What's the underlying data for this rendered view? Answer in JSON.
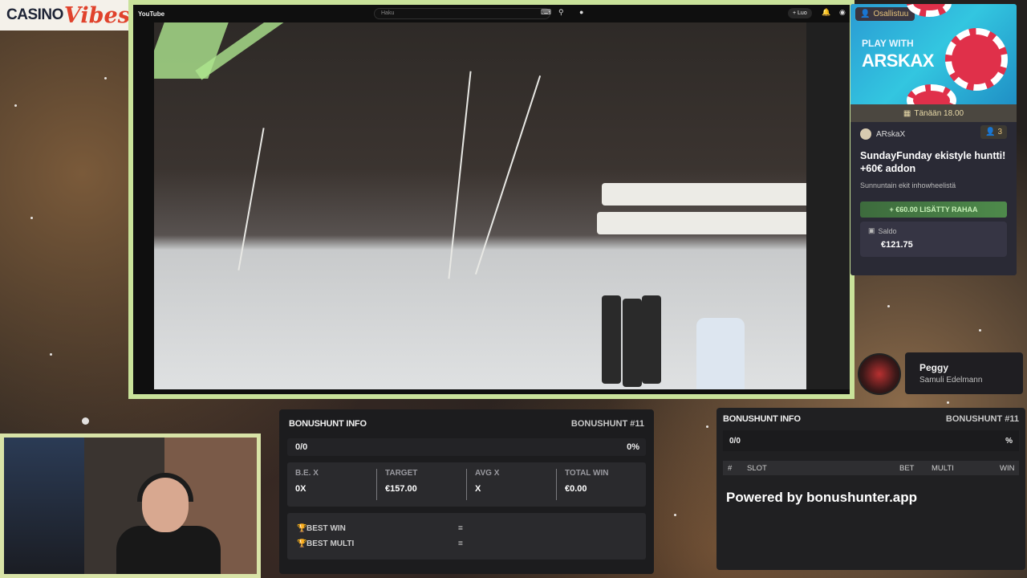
{
  "logo": {
    "casino": "CASINO",
    "vibes": "Vibes"
  },
  "youtube": {
    "logo_text": "YouTube",
    "search_placeholder": "Haku",
    "create_label": "+ Luo"
  },
  "event": {
    "joined_label": "Osallistuu",
    "banner_play_with": "PLAY WITH",
    "banner_name": "ARSKAX",
    "time": "Tänään 18.00",
    "host": "ARskaX",
    "participants": "3",
    "title": "SundayFunday ekistyle huntti! +60€ addon",
    "description": "Sunnuntain ekit inhowheelistä",
    "addon": "+ €60.00 LISÄTTY RAHAA",
    "balance_label": "Saldo",
    "balance_value": "€121.75"
  },
  "now_playing": {
    "title": "Peggy",
    "artist": "Samuli Edelmann"
  },
  "bonushunt": {
    "title": "BONUSHUNT INFO",
    "hunt_number": "BONUSHUNT #11",
    "progress": "0/0",
    "percent": "0%",
    "stats": [
      {
        "label": "B.E. X",
        "value": "0X"
      },
      {
        "label": "TARGET",
        "value": "€157.00"
      },
      {
        "label": "AVG X",
        "value": "X"
      },
      {
        "label": "TOTAL WIN",
        "value": "€0.00"
      }
    ],
    "best_win_label": "BEST WIN",
    "best_win_value": "=",
    "best_multi_label": "BEST MULTI",
    "best_multi_value": "="
  },
  "bonushunt2": {
    "title": "BONUSHUNT INFO",
    "hunt_number": "BONUSHUNT #11",
    "progress": "0/0",
    "percent": "%",
    "columns": [
      "#",
      "SLOT",
      "BET",
      "MULTI",
      "WIN"
    ],
    "powered_by": "Powered by bonushunter.app"
  },
  "colors": {
    "frame_green": "#c9e29a",
    "panel_dark": "#1c1c1e",
    "accent_gold": "#e6c27a",
    "addon_green": "#4e8a4b"
  }
}
